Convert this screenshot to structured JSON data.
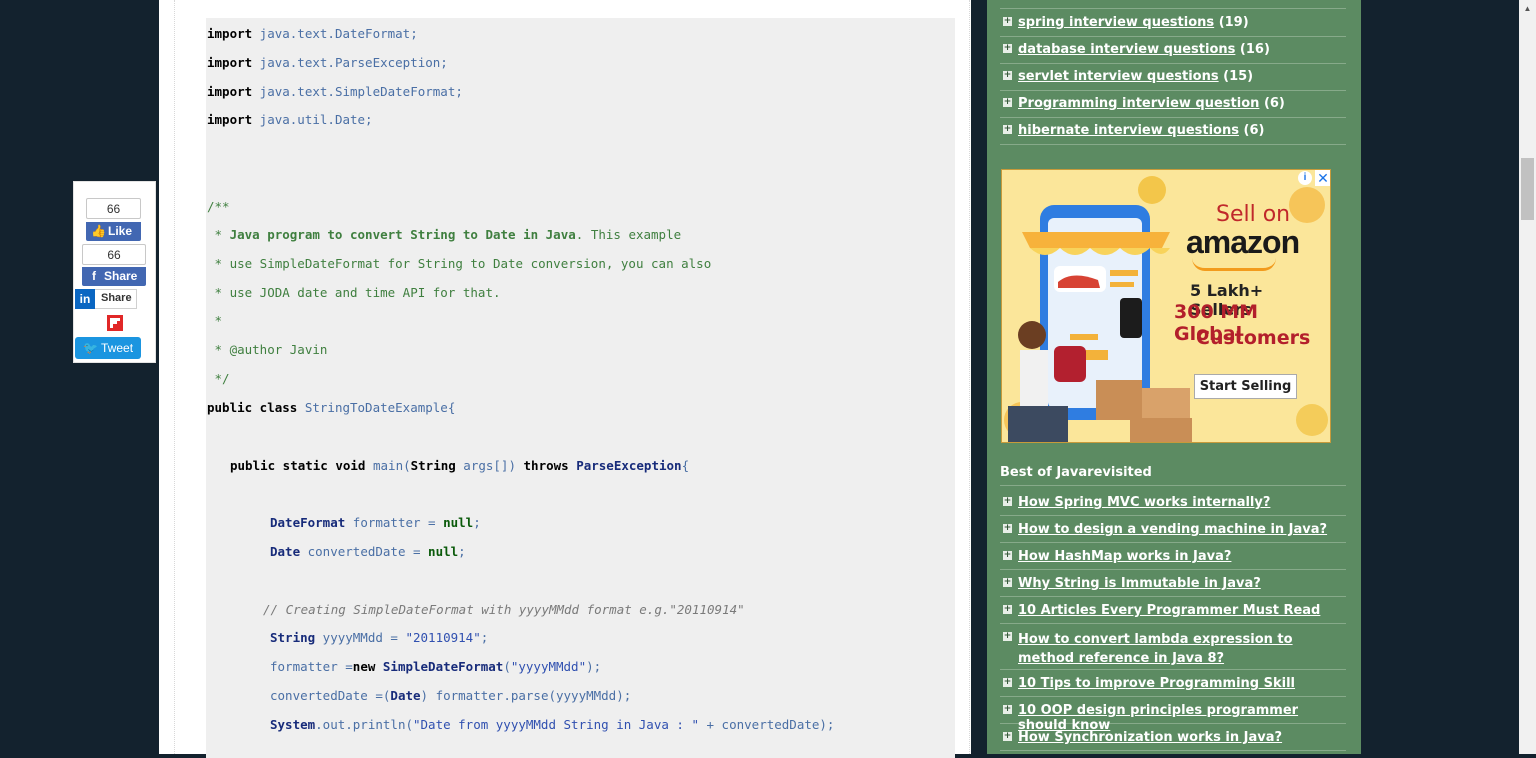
{
  "code": {
    "lines": [
      {
        "t": "import",
        "p": " java.text.DateFormat;"
      },
      {
        "t": "import",
        "p": " java.text.ParseException;"
      },
      {
        "t": "import",
        "p": " java.text.SimpleDateFormat;"
      },
      {
        "t": "import",
        "p": " java.util.Date;"
      }
    ],
    "doc_open": "/**",
    "doc_l1_star": " * ",
    "doc_l1_bold": "Java program to convert String to Date in Java",
    "doc_l1_rest": ". This example",
    "doc_l2": " * use SimpleDateFormat for String to Date conversion, you can also",
    "doc_l3": " * use JODA date and time API for that.",
    "doc_l4": " *",
    "doc_l5": " * @author Javin",
    "doc_close": " */",
    "class_kw": "public class",
    "class_name": " StringToDateExample{",
    "main_kw": "public static void",
    "main_name": " main(",
    "main_type": "String",
    "main_args": " args[]) ",
    "main_throws": "throws",
    "main_exc": " ParseException",
    "main_brace": "{",
    "decl1_type": "DateFormat",
    "decl1_rest": " formatter = ",
    "decl1_null": "null",
    "decl1_end": ";",
    "decl2_type": "Date",
    "decl2_rest": " convertedDate = ",
    "decl2_null": "null",
    "decl2_end": ";",
    "comment1": "// Creating SimpleDateFormat with yyyyMMdd format e.g.\"20110914\"",
    "s1_type": "String",
    "s1_rest": " yyyyMMdd = ",
    "s1_str": "\"20110914\"",
    "s1_end": ";",
    "s2_a": "formatter =",
    "s2_new": "new",
    "s2_type": " SimpleDateFormat",
    "s2_b": "(",
    "s2_str": "\"yyyyMMdd\"",
    "s2_c": ");",
    "s3_a": "convertedDate =(",
    "s3_type": "Date",
    "s3_b": ") formatter.parse(yyyyMMdd);",
    "s4_type": "System",
    "s4_a": ".out.println(",
    "s4_str": "\"Date from yyyyMMdd String in Java : \"",
    "s4_b": " + convertedDate);"
  },
  "share": {
    "like_count": "66",
    "like_label": "Like",
    "share_count": "66",
    "share_label": "Share",
    "linkedin_label": "Share",
    "linkedin_logo": "in",
    "tweet_label": "Tweet"
  },
  "sidebar": {
    "categories": [
      {
        "label": "spring interview questions",
        "count": "(19)"
      },
      {
        "label": "database interview questions",
        "count": "(16)"
      },
      {
        "label": "servlet interview questions",
        "count": "(15)"
      },
      {
        "label": "Programming interview question",
        "count": "(6)"
      },
      {
        "label": "hibernate interview questions",
        "count": "(6)"
      }
    ],
    "best_title": "Best of Javarevisited",
    "best": [
      "How Spring MVC works internally?",
      "How to design a vending machine in Java?",
      "How HashMap works in Java?",
      "Why String is Immutable in Java?",
      "10 Articles Every Programmer Must Read",
      "How to convert lambda expression to method reference in Java 8?",
      "10 Tips to improve Programming Skill",
      "10 OOP design principles programmer should know",
      "How Synchronization works in Java?"
    ]
  },
  "ad": {
    "sell_on": "Sell on",
    "brand": "amazon",
    "line1": "5 Lakh+ Sellers",
    "line2": "300 MM Global",
    "line3": "Customers",
    "cta": "Start Selling",
    "info": "i",
    "close": "✕"
  },
  "colors": {
    "page_bg": "#13222e",
    "sidebar_bg": "#5c8b62",
    "code_bg": "#efefef",
    "facebook": "#4267b2",
    "twitter": "#1b95e0",
    "linkedin": "#0a66c2"
  }
}
